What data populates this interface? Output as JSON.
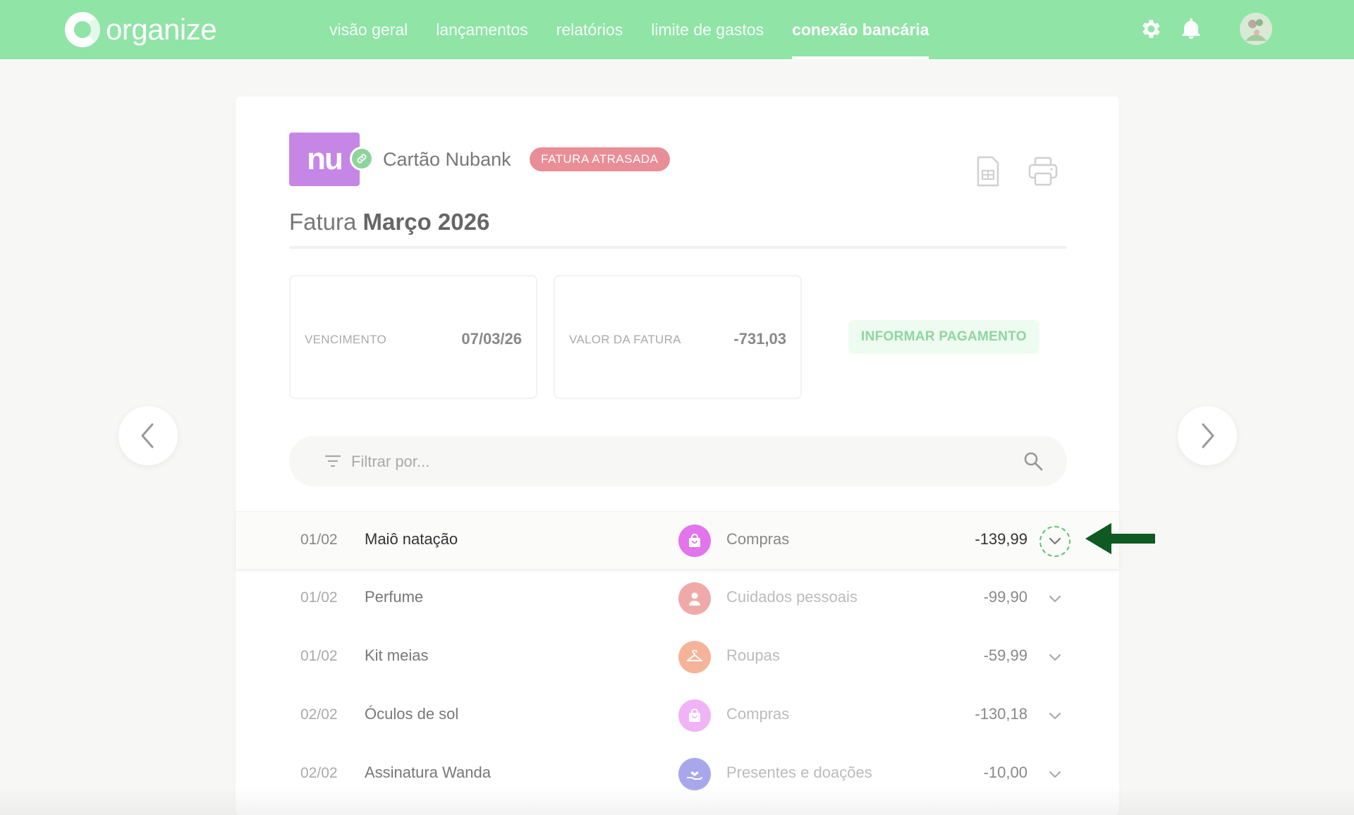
{
  "app": {
    "logo_text": "organize"
  },
  "nav": {
    "items": [
      {
        "label": "visão geral"
      },
      {
        "label": "lançamentos"
      },
      {
        "label": "relatórios"
      },
      {
        "label": "limite de gastos"
      },
      {
        "label": "conexão bancária"
      }
    ],
    "active": "conexão bancária"
  },
  "header_icons": [
    "gear-icon",
    "bell-icon",
    "avatar"
  ],
  "card": {
    "logo_text": "nu",
    "name": "Cartão Nubank",
    "status": "FATURA ATRASADA",
    "linked": true
  },
  "invoice": {
    "prefix": "Fatura",
    "period": "Março 2026",
    "due_label": "VENCIMENTO",
    "due_value": "07/03/26",
    "amount_label": "VALOR DA FATURA",
    "amount_value": "-731,03",
    "pay_button": "INFORMAR PAGAMENTO"
  },
  "search": {
    "placeholder": "Filtrar por..."
  },
  "transactions": [
    {
      "date": "01/02",
      "description": "Maiô natação",
      "category": "Compras",
      "icon": "shopping-bag-icon",
      "amount": "-139,99"
    },
    {
      "date": "01/02",
      "description": "Perfume",
      "category": "Cuidados pessoais",
      "icon": "person-icon",
      "amount": "-99,90"
    },
    {
      "date": "01/02",
      "description": "Kit meias",
      "category": "Roupas",
      "icon": "hanger-icon",
      "amount": "-59,99"
    },
    {
      "date": "02/02",
      "description": "Óculos de sol",
      "category": "Compras",
      "icon": "shopping-bag-icon",
      "amount": "-130,18"
    },
    {
      "date": "02/02",
      "description": "Assinatura Wanda",
      "category": "Presentes e doações",
      "icon": "gift-hand-icon",
      "amount": "-10,00"
    }
  ],
  "colors": {
    "topbar": "#8fe4a6",
    "status_badge": "#e98e96",
    "nubank": "#c686e6",
    "arrow_annotation": "#0f5a22"
  }
}
